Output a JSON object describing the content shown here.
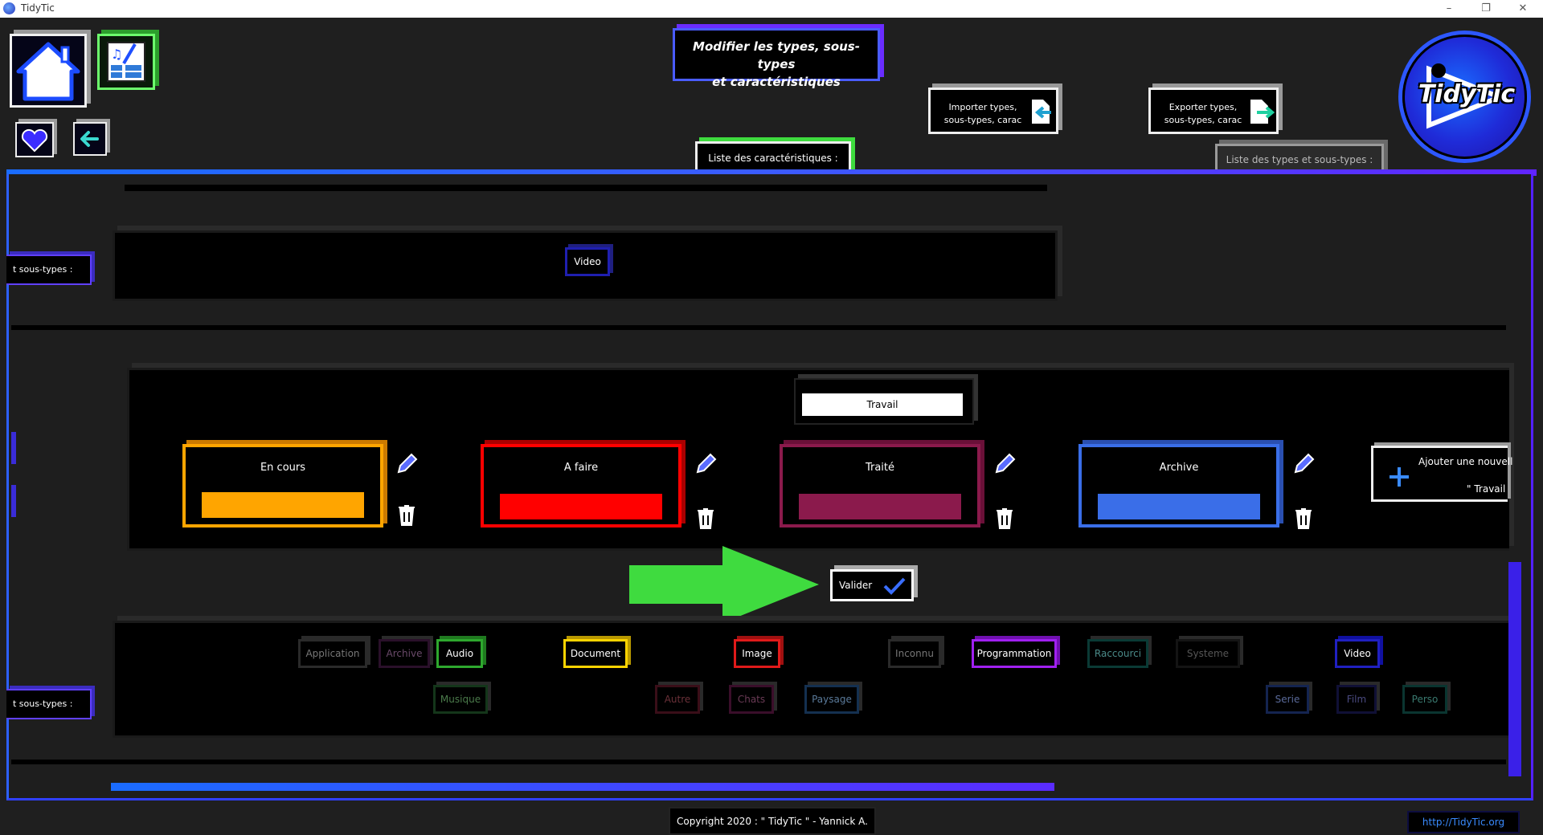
{
  "window": {
    "title": "TidyTic",
    "controls": [
      "–",
      "❐",
      "✕"
    ]
  },
  "header": {
    "title_line1": "Modifier les types, sous-types",
    "title_line2": "et caractéristiques"
  },
  "import_button": {
    "line1": "Importer types,",
    "line2": "sous-types, carac"
  },
  "export_button": {
    "line1": "Exporter types,",
    "line2": "sous-types, carac"
  },
  "tabs": {
    "characteristics": "Liste des caractéristiques :",
    "types": "Liste des types et sous-types :"
  },
  "logo": {
    "text": "TidyTic"
  },
  "side_tabs": {
    "top": "t sous-types :",
    "bottom": "t sous-types :"
  },
  "top_row": {
    "item": "Video"
  },
  "editor": {
    "type_name": "Travail",
    "cards": [
      {
        "name": "En cours",
        "color": "#ffa500"
      },
      {
        "name": "A faire",
        "color": "#ff0000"
      },
      {
        "name": "Traité",
        "color": "#8b1a4c"
      },
      {
        "name": "Archive",
        "color": "#3a6ee8"
      }
    ],
    "add_new_line1": "Ajouter une nouvell",
    "add_new_line2": "\" Travail"
  },
  "validate_button": "Valider",
  "types_row": {
    "row1": [
      {
        "label": "Application",
        "active": false,
        "color": "#555555"
      },
      {
        "label": "Archive",
        "active": false,
        "color": "#3a1a3a"
      },
      {
        "label": "Audio",
        "active": true,
        "color": "#2ea82e"
      },
      {
        "label": "Document",
        "active": true,
        "color": "#ffd400"
      },
      {
        "label": "Image",
        "active": true,
        "color": "#e01a1a"
      },
      {
        "label": "Inconnu",
        "active": false,
        "color": "#555555"
      },
      {
        "label": "Programmation",
        "active": true,
        "color": "#a020f0"
      },
      {
        "label": "Raccourci",
        "active": false,
        "color": "#0a5a55"
      },
      {
        "label": "Systeme",
        "active": false,
        "color": "#222222"
      },
      {
        "label": "Video",
        "active": true,
        "color": "#2020c0"
      }
    ],
    "row2": [
      {
        "label": "Musique",
        "active": false,
        "color": "#1a4a1a"
      },
      {
        "label": "Autre",
        "active": false,
        "color": "#4a1018"
      },
      {
        "label": "Chats",
        "active": false,
        "color": "#4a1030"
      },
      {
        "label": "Paysage",
        "active": false,
        "color": "#1a3a5a"
      },
      {
        "label": "Serie",
        "active": false,
        "color": "#1a2a5a"
      },
      {
        "label": "Film",
        "active": false,
        "color": "#141440"
      },
      {
        "label": "Perso",
        "active": false,
        "color": "#0a3a35"
      }
    ]
  },
  "footer": {
    "copyright": "Copyright 2020 : \" TidyTic \" - Yannick A.",
    "link": "http://TidyTic.org"
  }
}
